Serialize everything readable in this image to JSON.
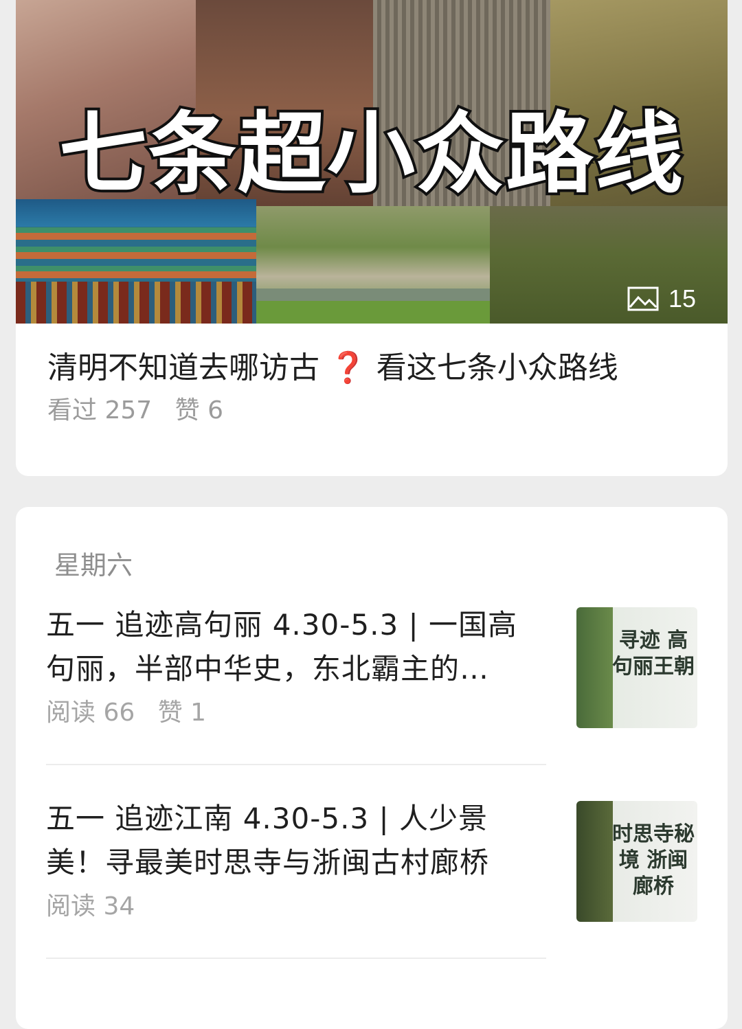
{
  "featured": {
    "cover_title": "七条超小众路线",
    "image_count": "15",
    "title_before": "清明不知道去哪访古",
    "title_mark": "❓",
    "title_after": "看这七条小众路线",
    "views_label": "看过 257",
    "likes_label": "赞 6"
  },
  "feed": {
    "day_label": "星期六",
    "items": [
      {
        "title": "五一 追迹高句丽 4.30-5.3 | 一国高句丽，半部中华史，东北霸主的…",
        "reads": "阅读 66",
        "likes": "赞 1",
        "thumb_text": "寻迹 高句丽王朝"
      },
      {
        "title": "五一 追迹江南 4.30-5.3 | 人少景美！寻最美时思寺与浙闽古村廊桥",
        "reads": "阅读 34",
        "thumb_text": "时思寺秘境 浙闽廊桥"
      }
    ]
  },
  "colors": {
    "background": "#ededed",
    "card": "#ffffff",
    "title_text": "#1f1f1f",
    "meta_text": "#9b9b9b",
    "question_mark": "#d9202a"
  }
}
